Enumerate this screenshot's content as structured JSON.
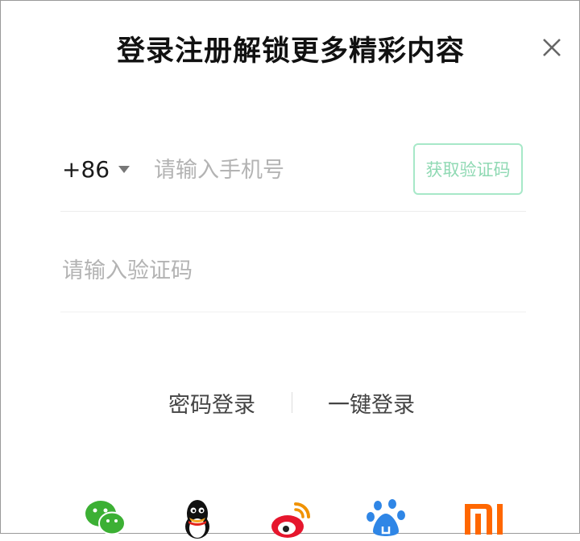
{
  "dialog": {
    "title": "登录注册解锁更多精彩内容"
  },
  "phone": {
    "country_code": "+86",
    "placeholder": "请输入手机号",
    "get_code_label": "获取验证码"
  },
  "verification": {
    "placeholder": "请输入验证码"
  },
  "alt_login": {
    "password_login": "密码登录",
    "one_click_login": "一键登录"
  },
  "social": [
    {
      "name": "wechat-icon",
      "color": "#3cb034"
    },
    {
      "name": "qq-icon",
      "color": "#000000"
    },
    {
      "name": "weibo-icon",
      "color": "#e6162d"
    },
    {
      "name": "baidu-icon",
      "color": "#2f86e6"
    },
    {
      "name": "xiaomi-icon",
      "color": "#ff6700"
    }
  ],
  "colors": {
    "accent_border": "#a7e8c8",
    "accent_text": "#8fd9b3"
  }
}
